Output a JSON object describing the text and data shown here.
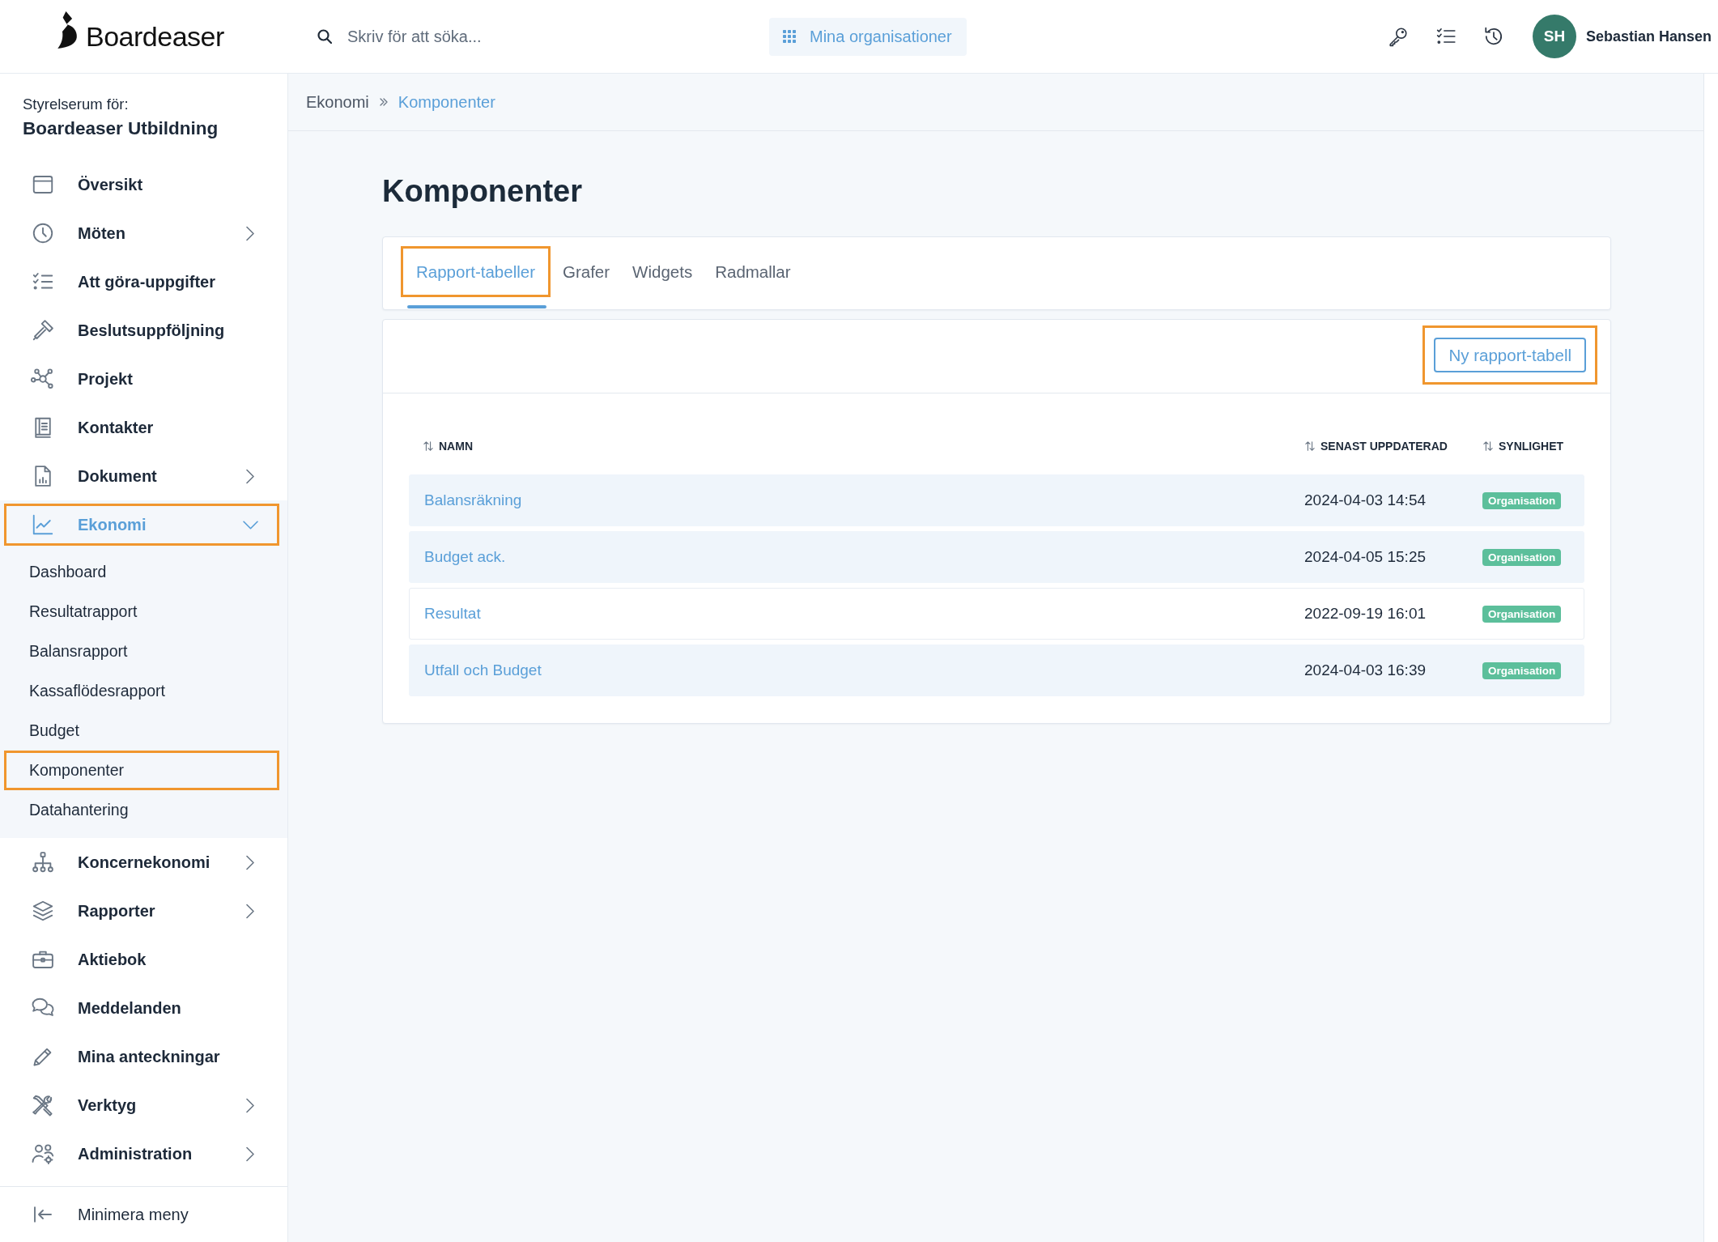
{
  "topbar": {
    "logo": "Boardeaser",
    "search": {
      "placeholder": "Skriv för att söka..."
    },
    "org_button": "Mina organisationer",
    "user": {
      "initials": "SH",
      "name": "Sebastian Hansen"
    }
  },
  "sidebar": {
    "caption": "Styrelserum för:",
    "org_name": "Boardeaser Utbildning",
    "items": [
      {
        "label": "Översikt",
        "selected": false,
        "highlighted": false,
        "expandable": false
      },
      {
        "label": "Möten",
        "selected": false,
        "highlighted": false,
        "expandable": true,
        "expanded": false
      },
      {
        "label": "Att göra-uppgifter",
        "selected": false,
        "highlighted": false,
        "expandable": false
      },
      {
        "label": "Beslutsuppföljning",
        "selected": false,
        "highlighted": false,
        "expandable": false
      },
      {
        "label": "Projekt",
        "selected": false,
        "highlighted": false,
        "expandable": false
      },
      {
        "label": "Kontakter",
        "selected": false,
        "highlighted": false,
        "expandable": false
      },
      {
        "label": "Dokument",
        "selected": false,
        "highlighted": false,
        "expandable": true,
        "expanded": false
      },
      {
        "label": "Ekonomi",
        "selected": true,
        "highlighted": true,
        "expandable": true,
        "expanded": true,
        "children": [
          {
            "label": "Dashboard",
            "highlighted": false
          },
          {
            "label": "Resultatrapport",
            "highlighted": false
          },
          {
            "label": "Balansrapport",
            "highlighted": false
          },
          {
            "label": "Kassaflödesrapport",
            "highlighted": false
          },
          {
            "label": "Budget",
            "highlighted": false
          },
          {
            "label": "Komponenter",
            "highlighted": true
          },
          {
            "label": "Datahantering",
            "highlighted": false
          }
        ]
      },
      {
        "label": "Koncernekonomi",
        "selected": false,
        "highlighted": false,
        "expandable": true,
        "expanded": false
      },
      {
        "label": "Rapporter",
        "selected": false,
        "highlighted": false,
        "expandable": true,
        "expanded": false
      },
      {
        "label": "Aktiebok",
        "selected": false,
        "highlighted": false,
        "expandable": false
      },
      {
        "label": "Meddelanden",
        "selected": false,
        "highlighted": false,
        "expandable": false
      },
      {
        "label": "Mina anteckningar",
        "selected": false,
        "highlighted": false,
        "expandable": false
      },
      {
        "label": "Verktyg",
        "selected": false,
        "highlighted": false,
        "expandable": true,
        "expanded": false
      },
      {
        "label": "Administration",
        "selected": false,
        "highlighted": false,
        "expandable": true,
        "expanded": false
      }
    ],
    "footer": "Minimera meny"
  },
  "breadcrumbs": [
    {
      "label": "Ekonomi",
      "current": false
    },
    {
      "label": "Komponenter",
      "current": true
    }
  ],
  "page_title": "Komponenter",
  "tabs": [
    {
      "label": "Rapport-tabeller",
      "selected": true,
      "highlighted": true
    },
    {
      "label": "Grafer",
      "selected": false,
      "highlighted": false
    },
    {
      "label": "Widgets",
      "selected": false,
      "highlighted": false
    },
    {
      "label": "Radmallar",
      "selected": false,
      "highlighted": false
    }
  ],
  "new_button": {
    "label": "Ny rapport-tabell",
    "highlighted": true
  },
  "table": {
    "columns": [
      {
        "label": "NAMN",
        "sortable": true
      },
      {
        "label": "SENAST UPPDATERAD",
        "sortable": true
      },
      {
        "label": "SYNLIGHET",
        "sortable": true
      }
    ],
    "rows": [
      {
        "name": "Balansräkning",
        "updated": "2024-04-03 14:54",
        "visibility": "Organisation",
        "shaded": true
      },
      {
        "name": "Budget ack.",
        "updated": "2024-04-05 15:25",
        "visibility": "Organisation",
        "shaded": true
      },
      {
        "name": "Resultat",
        "updated": "2022-09-19 16:01",
        "visibility": "Organisation",
        "shaded": false
      },
      {
        "name": "Utfall och Budget",
        "updated": "2024-04-03 16:39",
        "visibility": "Organisation",
        "shaded": true
      }
    ]
  }
}
